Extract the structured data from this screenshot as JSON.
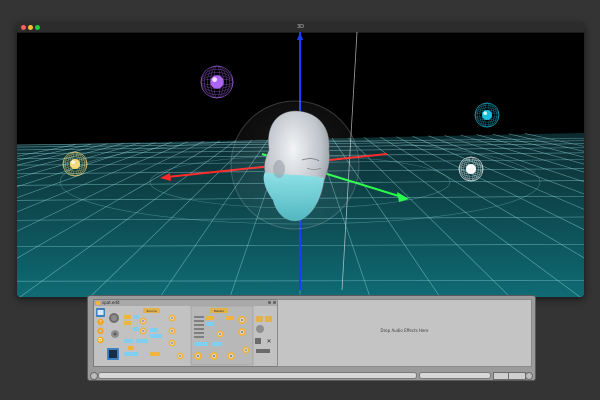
{
  "window": {
    "title": "3D"
  },
  "scene": {
    "colors": {
      "floor_top": "#0c2b2f",
      "floor_bottom": "#0f6b74",
      "grid": "#9fe8ee",
      "x_axis": "#ff2a2a",
      "y_axis": "#1b3cff",
      "z_axis": "#29ff4a",
      "bubble": "#d8d8d8",
      "head": "#cfd3d8",
      "head_lower": "#6fd2d9"
    },
    "light_colors": [
      "#b36bff",
      "#1bc6e6",
      "#ffe27a",
      "#ffffff"
    ]
  },
  "device": {
    "title": "spat.edit",
    "section_left": "Source",
    "section_right": "Master"
  },
  "drop_area": {
    "text": "Drop Audio Effects Here"
  }
}
